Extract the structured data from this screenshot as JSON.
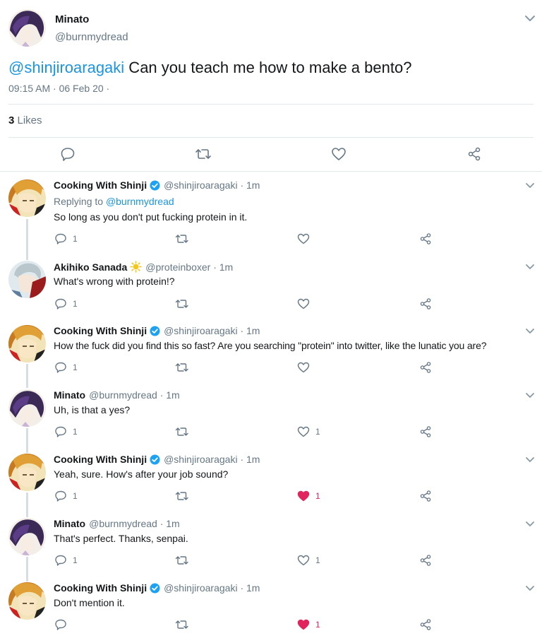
{
  "main_tweet": {
    "author_name": "Minato",
    "author_handle": "@burnmydread",
    "mention": "@shinjiroaragaki",
    "text": " Can you teach me how to make a bento?",
    "timestamp": "09:15 AM · 06 Feb 20 ·",
    "likes_count": "3",
    "likes_label": " Likes",
    "avatar_icon": "minato-avatar",
    "actions": [
      "reply-icon",
      "retweet-icon",
      "like-icon",
      "share-icon"
    ]
  },
  "replies": [
    {
      "author_name": "Cooking With Shinji",
      "verified": true,
      "author_handle": "@shinjiroaragaki · 1m",
      "replying_prefix": "Replying to ",
      "replying_to": "@burnmydread",
      "text": "So long as you don't put fucking protein in it.",
      "reply_count": "1",
      "like_count": "",
      "liked": false
    },
    {
      "author_name": "Akihiko Sanada",
      "badge_icon": "sun-emoji-icon",
      "author_handle": "@proteinboxer · 1m",
      "text": "What's wrong with protein!?",
      "reply_count": "1",
      "like_count": "",
      "liked": false
    },
    {
      "author_name": "Cooking With Shinji",
      "verified": true,
      "author_handle": "@shinjiroaragaki · 1m",
      "text": "How the fuck did you find this so fast? Are you searching \"protein\" into twitter, like the lunatic you are?",
      "reply_count": "1",
      "like_count": "",
      "liked": false
    },
    {
      "author_name": "Minato",
      "author_handle": "@burnmydread · 1m",
      "text": "Uh, is that a yes?",
      "reply_count": "1",
      "like_count": "1",
      "liked": false
    },
    {
      "author_name": "Cooking With Shinji",
      "verified": true,
      "author_handle": "@shinjiroaragaki · 1m",
      "text": "Yeah, sure. How's after your job sound?",
      "reply_count": "1",
      "like_count": "1",
      "liked": true
    },
    {
      "author_name": "Minato",
      "author_handle": "@burnmydread · 1m",
      "text": "That's perfect. Thanks, senpai.",
      "reply_count": "1",
      "like_count": "1",
      "liked": false
    },
    {
      "author_name": "Cooking With Shinji",
      "verified": true,
      "author_handle": "@shinjiroaragaki · 1m",
      "text": "Don't mention it.",
      "reply_count": "",
      "like_count": "1",
      "liked": true
    }
  ],
  "colors": {
    "link": "#1b95e0",
    "muted": "#657786",
    "liked": "#e0245e",
    "divider": "#e1e8ed",
    "verified": "#1da1f2"
  }
}
